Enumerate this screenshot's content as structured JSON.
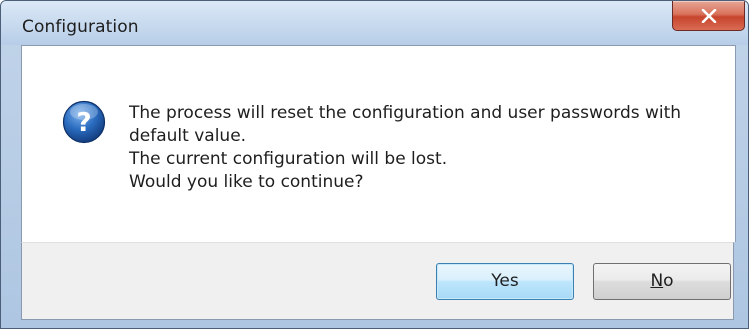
{
  "window": {
    "title": "Configuration"
  },
  "dialog": {
    "icon": "question-icon",
    "message_lines": [
      "The process will reset the configuration and user passwords with",
      "default value.",
      "The current configuration will be lost.",
      "Would you like to continue?"
    ]
  },
  "buttons": {
    "yes_label": "Yes",
    "no_label_first": "N",
    "no_label_rest": "o"
  },
  "colors": {
    "close_button": "#c7442c",
    "icon_blue": "#1f5fae",
    "default_button_border": "#3c7fb1"
  }
}
